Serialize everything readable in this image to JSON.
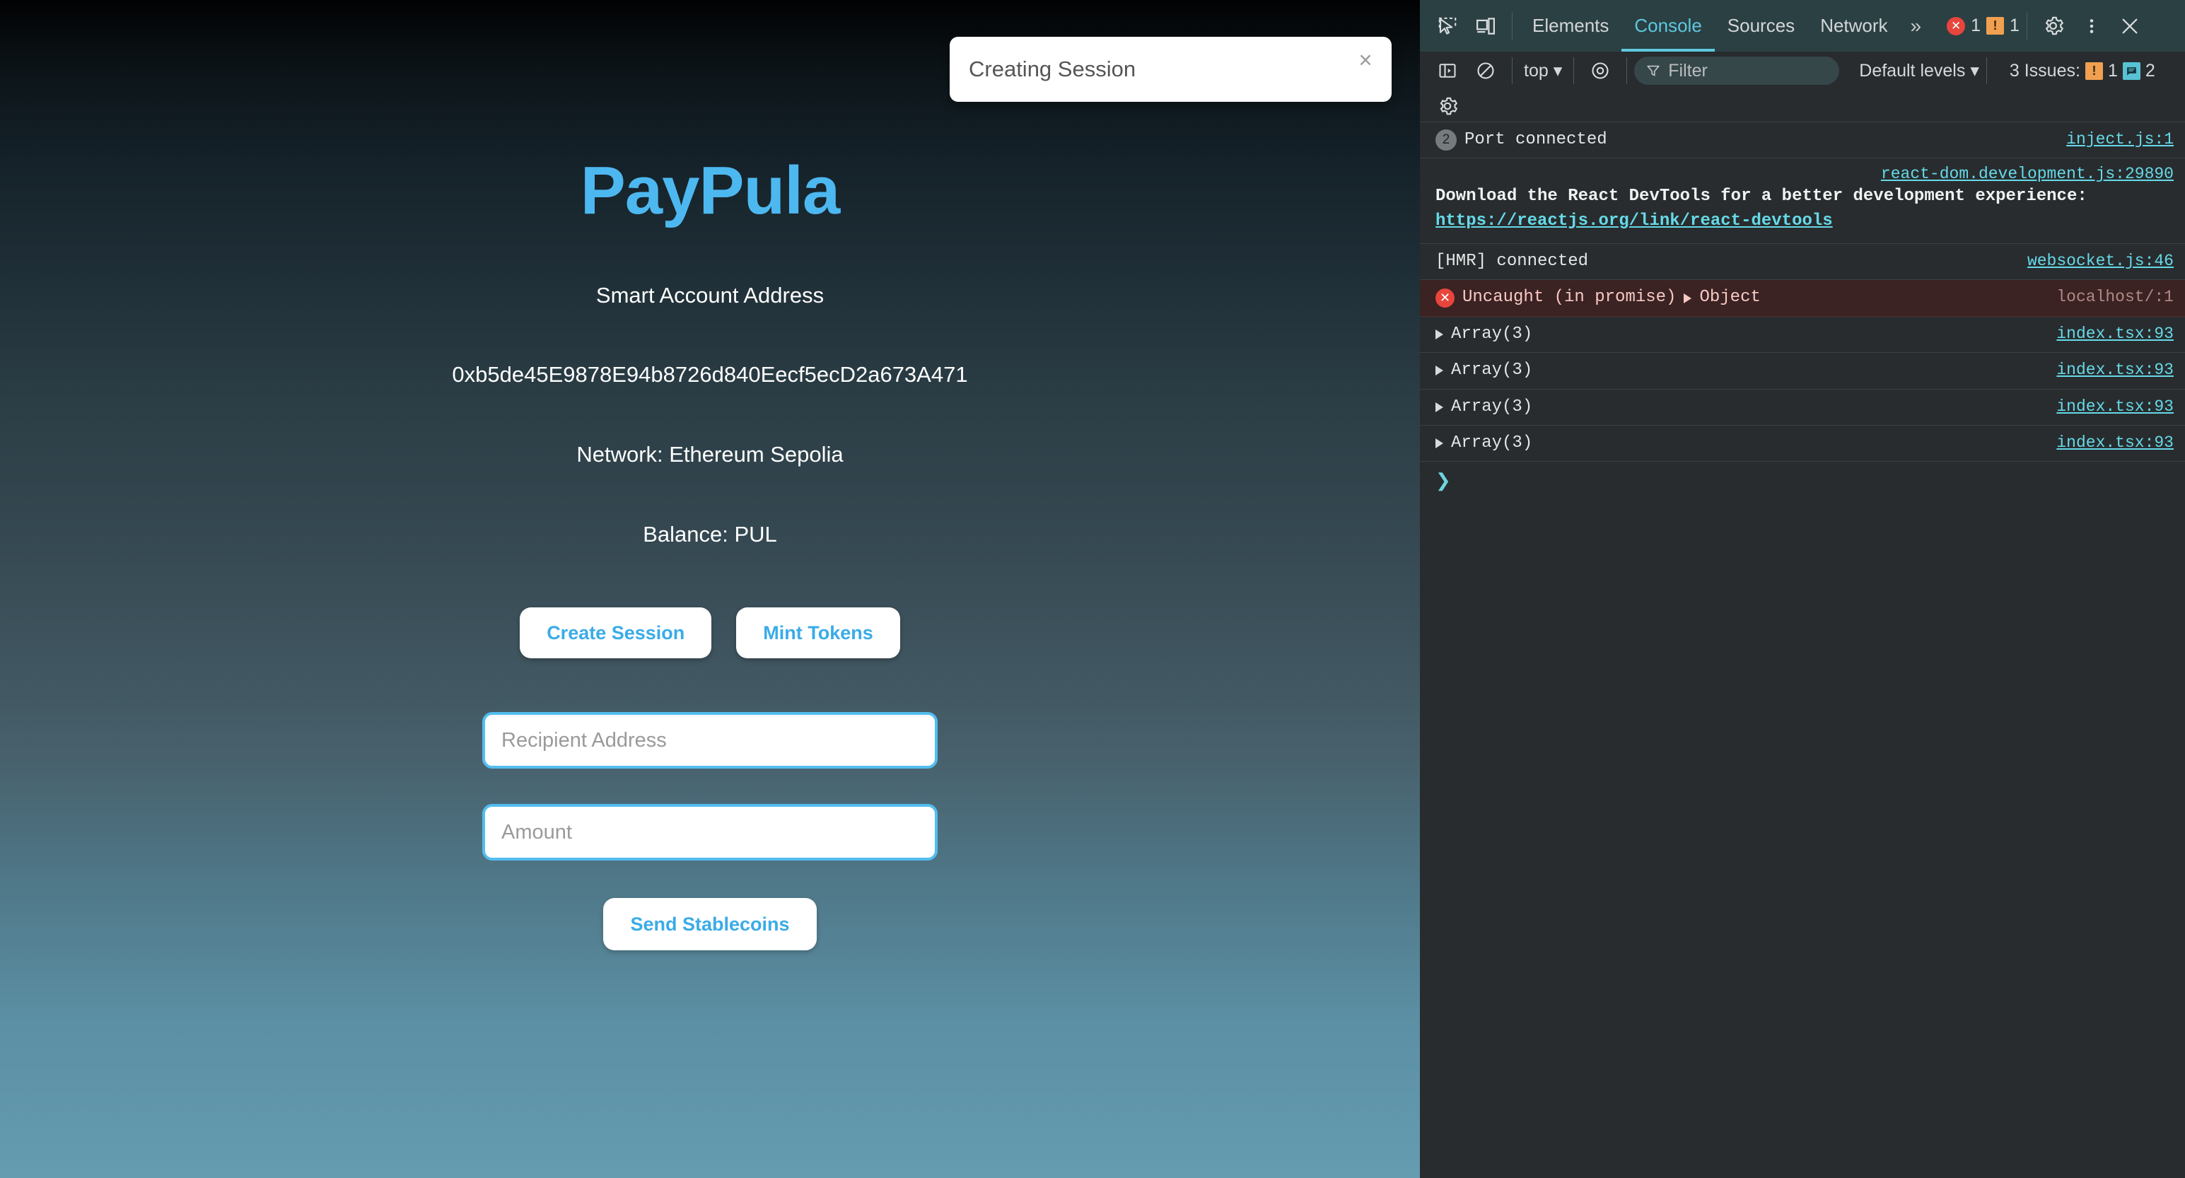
{
  "page": {
    "brand": "PayPula",
    "labels": {
      "account_label": "Smart Account Address",
      "account_address": "0xb5de45E9878E94b8726d840Eecf5ecD2a673A471",
      "network": "Network: Ethereum Sepolia",
      "balance": "Balance: PUL"
    },
    "buttons": {
      "create_session": "Create Session",
      "mint_tokens": "Mint Tokens",
      "send_stablecoins": "Send Stablecoins"
    },
    "inputs": {
      "recipient_placeholder": "Recipient Address",
      "recipient_value": "",
      "amount_placeholder": "Amount",
      "amount_value": ""
    },
    "toast": {
      "message": "Creating Session",
      "close_label": "×"
    },
    "colors": {
      "accent": "#4db8f0",
      "button_text": "#3aabe8",
      "input_border": "#53bdf0",
      "gradient_top": "#010203",
      "gradient_bottom": "#659cb0"
    }
  },
  "devtools": {
    "tabs": [
      {
        "label": "Elements",
        "active": false
      },
      {
        "label": "Console",
        "active": true
      },
      {
        "label": "Sources",
        "active": false
      },
      {
        "label": "Network",
        "active": false
      }
    ],
    "more_tabs_label": "»",
    "error_badge_count": "1",
    "warning_badge_count": "1",
    "toolbar": {
      "context": "top",
      "context_caret": "▾",
      "filter_placeholder": "Filter",
      "filter_value": "",
      "levels": "Default levels",
      "levels_caret": "▾",
      "issues_label": "3 Issues:",
      "issues_warning_count": "1",
      "issues_info_count": "2"
    },
    "logs": [
      {
        "kind": "repeat",
        "count": "2",
        "text": "Port connected",
        "source": "inject.js:1"
      },
      {
        "kind": "react",
        "source": "react-dom.development.js:29890",
        "text": "Download the React DevTools for a better development experience:",
        "link": "https://reactjs.org/link/react-devtools"
      },
      {
        "kind": "plain",
        "text": "[HMR] connected",
        "source": "websocket.js:46"
      },
      {
        "kind": "error",
        "text": "Uncaught (in promise)",
        "expandable": "Object",
        "source": "localhost/:1"
      },
      {
        "kind": "object",
        "text": "Array(3)",
        "source": "index.tsx:93"
      },
      {
        "kind": "object",
        "text": "Array(3)",
        "source": "index.tsx:93"
      },
      {
        "kind": "object",
        "text": "Array(3)",
        "source": "index.tsx:93"
      },
      {
        "kind": "object",
        "text": "Array(3)",
        "source": "index.tsx:93"
      }
    ],
    "prompt_arrow": "❯"
  }
}
